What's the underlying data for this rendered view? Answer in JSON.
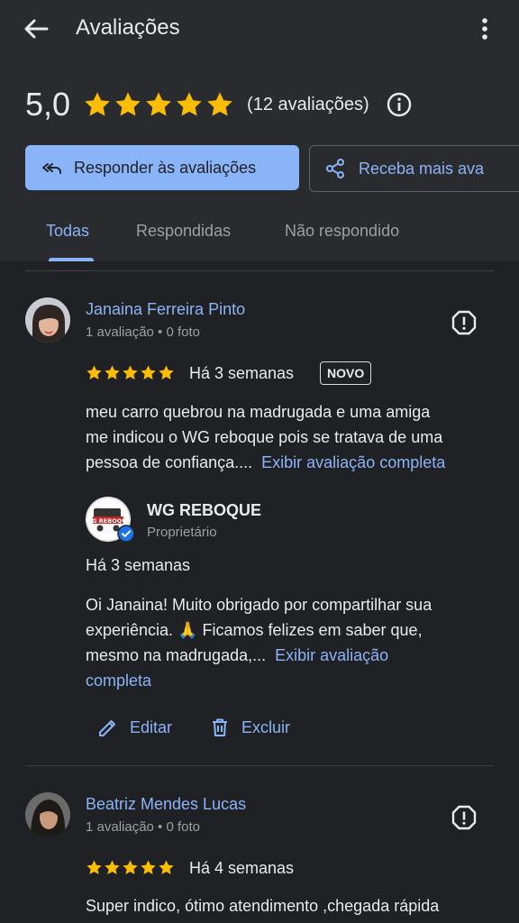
{
  "header": {
    "title": "Avaliações",
    "rating_value": "5,0",
    "rating_stars": 5,
    "review_count": "(12 avaliações)",
    "reply_button": "Responder às avaliações",
    "more_button": "Receba mais ava"
  },
  "tabs": [
    {
      "label": "Todas",
      "active": true
    },
    {
      "label": "Respondidas",
      "active": false
    },
    {
      "label": "Não respondido",
      "active": false
    }
  ],
  "reviews": [
    {
      "name": "Janaina Ferreira Pinto",
      "meta": "1 avaliação • 0 foto",
      "stars": 5,
      "time": "Há 3 semanas",
      "badge": "NOVO",
      "text_line1": "meu carro quebrou na madrugada e uma amiga",
      "text_line2": "me indicou o WG reboque pois se tratava de uma",
      "text_line3": "pessoa de confiança....",
      "expand": "Exibir avaliação completa",
      "reply": {
        "owner_name": "WG REBOQUE",
        "owner_role": "Proprietário",
        "logo_text": "WG REBOQUE",
        "time": "Há 3 semanas",
        "text_line1": "Oi Janaina! Muito obrigado por compartilhar sua",
        "text_line2": "experiência. 🙏 Ficamos felizes em saber que,",
        "text_line3": "mesmo na madrugada,...",
        "expand_part1": "Exibir avaliação",
        "expand_part2": "completa"
      },
      "edit": "Editar",
      "delete": "Excluir"
    },
    {
      "name": "Beatriz Mendes Lucas",
      "meta": "1 avaliação • 0 foto",
      "stars": 5,
      "time": "Há 4 semanas",
      "text_line1": "Super indico, ótimo atendimento ,chegada rápida"
    }
  ],
  "colors": {
    "background": "#202124",
    "header": "#2a2b2e",
    "accent": "#8ab4f8",
    "star": "#fbbc04"
  }
}
